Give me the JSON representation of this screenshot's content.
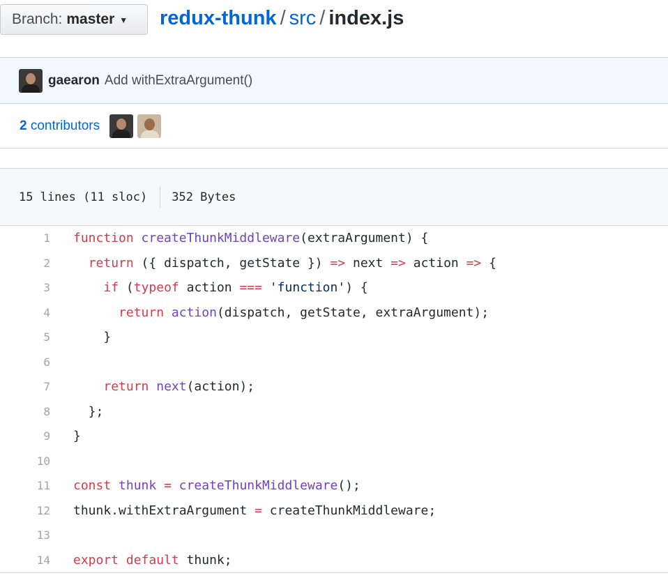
{
  "branch": {
    "prefix": "Branch:",
    "name": "master"
  },
  "breadcrumb": {
    "repo": "redux-thunk",
    "dir": "src",
    "file": "index.js",
    "separator": "/"
  },
  "commit": {
    "author": "gaearon",
    "message": "Add withExtraArgument()"
  },
  "contributors": {
    "count": "2",
    "label": "contributors"
  },
  "file_info": {
    "lines": "15 lines (11 sloc)",
    "size": "352 Bytes"
  },
  "code": [
    {
      "n": "1",
      "tokens": [
        [
          "k",
          "function"
        ],
        [
          "p",
          " "
        ],
        [
          "f",
          "createThunkMiddleware"
        ],
        [
          "p",
          "(extraArgument) {"
        ]
      ]
    },
    {
      "n": "2",
      "tokens": [
        [
          "p",
          "  "
        ],
        [
          "k",
          "return"
        ],
        [
          "p",
          " ({ dispatch, getState }) "
        ],
        [
          "o",
          "=>"
        ],
        [
          "p",
          " next "
        ],
        [
          "o",
          "=>"
        ],
        [
          "p",
          " action "
        ],
        [
          "o",
          "=>"
        ],
        [
          "p",
          " {"
        ]
      ]
    },
    {
      "n": "3",
      "tokens": [
        [
          "p",
          "    "
        ],
        [
          "k",
          "if"
        ],
        [
          "p",
          " ("
        ],
        [
          "k",
          "typeof"
        ],
        [
          "p",
          " action "
        ],
        [
          "o",
          "==="
        ],
        [
          "p",
          " "
        ],
        [
          "s",
          "'function'"
        ],
        [
          "p",
          ") {"
        ]
      ]
    },
    {
      "n": "4",
      "tokens": [
        [
          "p",
          "      "
        ],
        [
          "k",
          "return"
        ],
        [
          "p",
          " "
        ],
        [
          "f",
          "action"
        ],
        [
          "p",
          "(dispatch, getState, extraArgument);"
        ]
      ]
    },
    {
      "n": "5",
      "tokens": [
        [
          "p",
          "    }"
        ]
      ]
    },
    {
      "n": "6",
      "tokens": []
    },
    {
      "n": "7",
      "tokens": [
        [
          "p",
          "    "
        ],
        [
          "k",
          "return"
        ],
        [
          "p",
          " "
        ],
        [
          "f",
          "next"
        ],
        [
          "p",
          "(action);"
        ]
      ]
    },
    {
      "n": "8",
      "tokens": [
        [
          "p",
          "  };"
        ]
      ]
    },
    {
      "n": "9",
      "tokens": [
        [
          "p",
          "}"
        ]
      ]
    },
    {
      "n": "10",
      "tokens": []
    },
    {
      "n": "11",
      "tokens": [
        [
          "k",
          "const"
        ],
        [
          "p",
          " "
        ],
        [
          "f",
          "thunk"
        ],
        [
          "p",
          " "
        ],
        [
          "o",
          "="
        ],
        [
          "p",
          " "
        ],
        [
          "f",
          "createThunkMiddleware"
        ],
        [
          "p",
          "();"
        ]
      ]
    },
    {
      "n": "12",
      "tokens": [
        [
          "p",
          "thunk.withExtraArgument "
        ],
        [
          "o",
          "="
        ],
        [
          "p",
          " createThunkMiddleware;"
        ]
      ]
    },
    {
      "n": "13",
      "tokens": []
    },
    {
      "n": "14",
      "tokens": [
        [
          "k",
          "export"
        ],
        [
          "p",
          " "
        ],
        [
          "k",
          "default"
        ],
        [
          "p",
          " thunk;"
        ]
      ]
    }
  ],
  "colors": {
    "link": "#0366d6",
    "keyword": "#d73a49",
    "function": "#6f42c1",
    "string": "#032f62",
    "commit_bg": "#f1f8ff",
    "header_bg": "#f6f8fa"
  }
}
